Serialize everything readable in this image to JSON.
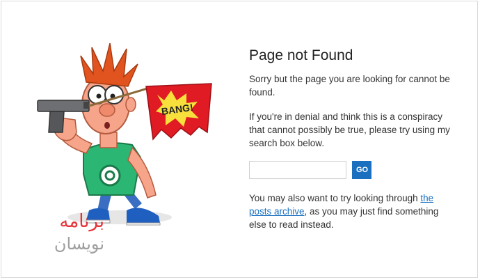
{
  "page": {
    "title": "Page not Found",
    "sorry_text": "Sorry but the page you are looking for cannot be found.",
    "denial_text": "If you're in denial and think this is a conspiracy that cannot possibly be true, please try using my search box below.",
    "search": {
      "value": "",
      "placeholder": "",
      "button_label": "GO"
    },
    "archive_prefix": "You may also want to try looking through",
    "archive_link": "the posts archive",
    "archive_suffix": ", as you may just find something else to read instead."
  },
  "illustration": {
    "flag_text": "BANG!"
  },
  "watermark": {
    "line1": "برنامه",
    "line2": "نویسان"
  },
  "colors": {
    "accent": "#1a6fbf",
    "flag_red": "#e01b24",
    "flag_yellow": "#f7e03c",
    "shirt_green": "#2bb673",
    "watermark_red": "#e31e24"
  },
  "icons": [
    "cartoon-character",
    "gun-icon",
    "bang-flag"
  ]
}
